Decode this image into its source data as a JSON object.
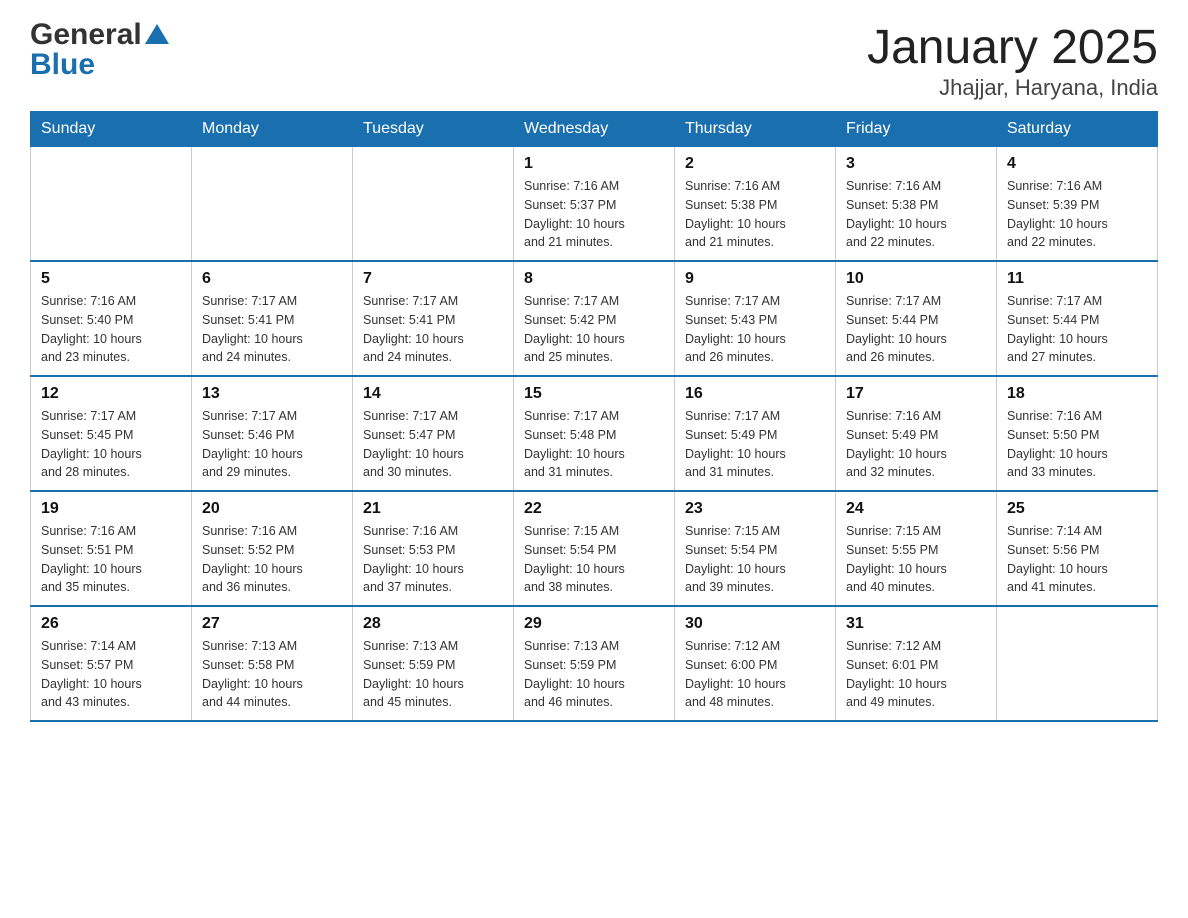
{
  "header": {
    "logo_general": "General",
    "logo_blue": "Blue",
    "title": "January 2025",
    "subtitle": "Jhajjar, Haryana, India"
  },
  "days_of_week": [
    "Sunday",
    "Monday",
    "Tuesday",
    "Wednesday",
    "Thursday",
    "Friday",
    "Saturday"
  ],
  "weeks": [
    [
      {
        "day": "",
        "info": ""
      },
      {
        "day": "",
        "info": ""
      },
      {
        "day": "",
        "info": ""
      },
      {
        "day": "1",
        "info": "Sunrise: 7:16 AM\nSunset: 5:37 PM\nDaylight: 10 hours\nand 21 minutes."
      },
      {
        "day": "2",
        "info": "Sunrise: 7:16 AM\nSunset: 5:38 PM\nDaylight: 10 hours\nand 21 minutes."
      },
      {
        "day": "3",
        "info": "Sunrise: 7:16 AM\nSunset: 5:38 PM\nDaylight: 10 hours\nand 22 minutes."
      },
      {
        "day": "4",
        "info": "Sunrise: 7:16 AM\nSunset: 5:39 PM\nDaylight: 10 hours\nand 22 minutes."
      }
    ],
    [
      {
        "day": "5",
        "info": "Sunrise: 7:16 AM\nSunset: 5:40 PM\nDaylight: 10 hours\nand 23 minutes."
      },
      {
        "day": "6",
        "info": "Sunrise: 7:17 AM\nSunset: 5:41 PM\nDaylight: 10 hours\nand 24 minutes."
      },
      {
        "day": "7",
        "info": "Sunrise: 7:17 AM\nSunset: 5:41 PM\nDaylight: 10 hours\nand 24 minutes."
      },
      {
        "day": "8",
        "info": "Sunrise: 7:17 AM\nSunset: 5:42 PM\nDaylight: 10 hours\nand 25 minutes."
      },
      {
        "day": "9",
        "info": "Sunrise: 7:17 AM\nSunset: 5:43 PM\nDaylight: 10 hours\nand 26 minutes."
      },
      {
        "day": "10",
        "info": "Sunrise: 7:17 AM\nSunset: 5:44 PM\nDaylight: 10 hours\nand 26 minutes."
      },
      {
        "day": "11",
        "info": "Sunrise: 7:17 AM\nSunset: 5:44 PM\nDaylight: 10 hours\nand 27 minutes."
      }
    ],
    [
      {
        "day": "12",
        "info": "Sunrise: 7:17 AM\nSunset: 5:45 PM\nDaylight: 10 hours\nand 28 minutes."
      },
      {
        "day": "13",
        "info": "Sunrise: 7:17 AM\nSunset: 5:46 PM\nDaylight: 10 hours\nand 29 minutes."
      },
      {
        "day": "14",
        "info": "Sunrise: 7:17 AM\nSunset: 5:47 PM\nDaylight: 10 hours\nand 30 minutes."
      },
      {
        "day": "15",
        "info": "Sunrise: 7:17 AM\nSunset: 5:48 PM\nDaylight: 10 hours\nand 31 minutes."
      },
      {
        "day": "16",
        "info": "Sunrise: 7:17 AM\nSunset: 5:49 PM\nDaylight: 10 hours\nand 31 minutes."
      },
      {
        "day": "17",
        "info": "Sunrise: 7:16 AM\nSunset: 5:49 PM\nDaylight: 10 hours\nand 32 minutes."
      },
      {
        "day": "18",
        "info": "Sunrise: 7:16 AM\nSunset: 5:50 PM\nDaylight: 10 hours\nand 33 minutes."
      }
    ],
    [
      {
        "day": "19",
        "info": "Sunrise: 7:16 AM\nSunset: 5:51 PM\nDaylight: 10 hours\nand 35 minutes."
      },
      {
        "day": "20",
        "info": "Sunrise: 7:16 AM\nSunset: 5:52 PM\nDaylight: 10 hours\nand 36 minutes."
      },
      {
        "day": "21",
        "info": "Sunrise: 7:16 AM\nSunset: 5:53 PM\nDaylight: 10 hours\nand 37 minutes."
      },
      {
        "day": "22",
        "info": "Sunrise: 7:15 AM\nSunset: 5:54 PM\nDaylight: 10 hours\nand 38 minutes."
      },
      {
        "day": "23",
        "info": "Sunrise: 7:15 AM\nSunset: 5:54 PM\nDaylight: 10 hours\nand 39 minutes."
      },
      {
        "day": "24",
        "info": "Sunrise: 7:15 AM\nSunset: 5:55 PM\nDaylight: 10 hours\nand 40 minutes."
      },
      {
        "day": "25",
        "info": "Sunrise: 7:14 AM\nSunset: 5:56 PM\nDaylight: 10 hours\nand 41 minutes."
      }
    ],
    [
      {
        "day": "26",
        "info": "Sunrise: 7:14 AM\nSunset: 5:57 PM\nDaylight: 10 hours\nand 43 minutes."
      },
      {
        "day": "27",
        "info": "Sunrise: 7:13 AM\nSunset: 5:58 PM\nDaylight: 10 hours\nand 44 minutes."
      },
      {
        "day": "28",
        "info": "Sunrise: 7:13 AM\nSunset: 5:59 PM\nDaylight: 10 hours\nand 45 minutes."
      },
      {
        "day": "29",
        "info": "Sunrise: 7:13 AM\nSunset: 5:59 PM\nDaylight: 10 hours\nand 46 minutes."
      },
      {
        "day": "30",
        "info": "Sunrise: 7:12 AM\nSunset: 6:00 PM\nDaylight: 10 hours\nand 48 minutes."
      },
      {
        "day": "31",
        "info": "Sunrise: 7:12 AM\nSunset: 6:01 PM\nDaylight: 10 hours\nand 49 minutes."
      },
      {
        "day": "",
        "info": ""
      }
    ]
  ]
}
